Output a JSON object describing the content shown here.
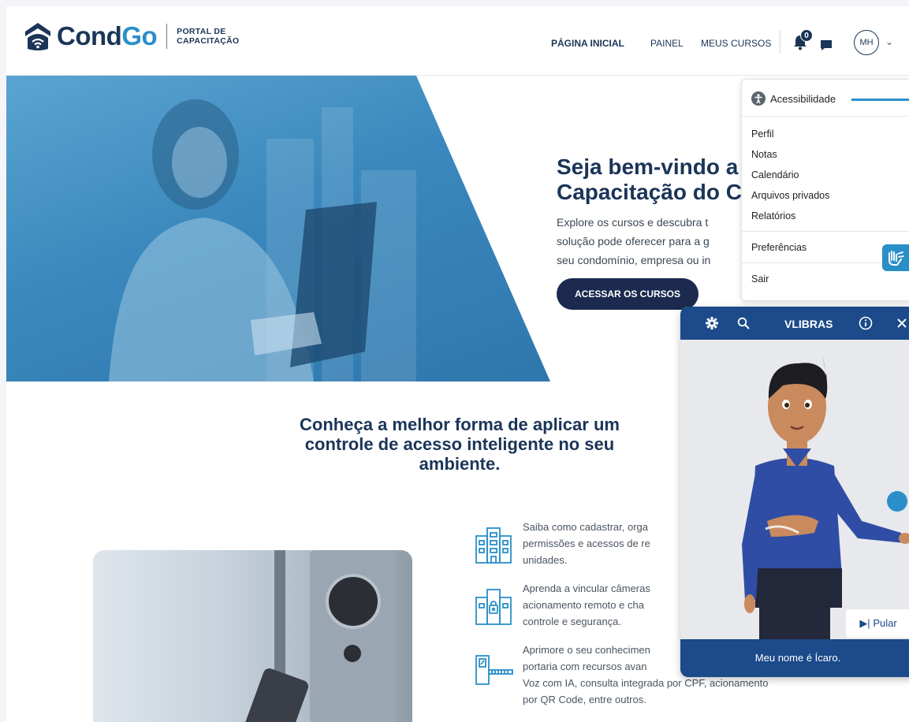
{
  "header": {
    "logo_cond": "Cond",
    "logo_go": "Go",
    "logo_sub_line1": "PORTAL DE",
    "logo_sub_line2": "CAPACITAÇÃO",
    "nav": {
      "home": "PÁGINA INICIAL",
      "painel": "PAINEL",
      "cursos": "MEUS CURSOS"
    },
    "notification_count": "0",
    "avatar_initials": "MH",
    "caret_icon": "chevron-down-icon"
  },
  "hero": {
    "title_line1": "Seja bem-vindo a",
    "title_line2": "Capacitação do C",
    "text_line1": "Explore os cursos e descubra t",
    "text_line2": "solução pode oferecer para a g",
    "text_line3": "seu condomínio, empresa ou in",
    "button": "ACESSAR OS CURSOS"
  },
  "section": {
    "title": "Conheça a melhor forma de aplicar um controle de acesso inteligente no seu ambiente.",
    "features": [
      {
        "icon": "building-icon",
        "line1": "Saiba como cadastrar, orga",
        "line2": "permissões e acessos de re",
        "line3": "unidades."
      },
      {
        "icon": "building-lock-icon",
        "line1": "Aprenda a vincular câmeras",
        "line2": "acionamento remoto e cha",
        "line3": "controle e segurança."
      },
      {
        "icon": "gate-icon",
        "line1": "Aprimore o seu conhecimen",
        "line2": "portaria com recursos avan",
        "line3": "Voz com IA, consulta integrada por CPF, acionamento",
        "line4": "por QR Code, entre outros."
      }
    ]
  },
  "menu": {
    "accessibility": "Acessibilidade",
    "items": [
      "Perfil",
      "Notas",
      "Calendário",
      "Arquivos privados",
      "Relatórios",
      "Preferências",
      "Sair"
    ]
  },
  "vlibras": {
    "title": "VLIBRAS",
    "skip": "Pular",
    "caption": "Meu nome é Ícaro.",
    "icons": [
      "gear-icon",
      "search-icon",
      "info-icon",
      "close-icon"
    ]
  },
  "colors": {
    "brand_dark": "#1b3558",
    "brand_blue": "#2a8fc9",
    "vlibras_blue": "#1c4a8a"
  }
}
